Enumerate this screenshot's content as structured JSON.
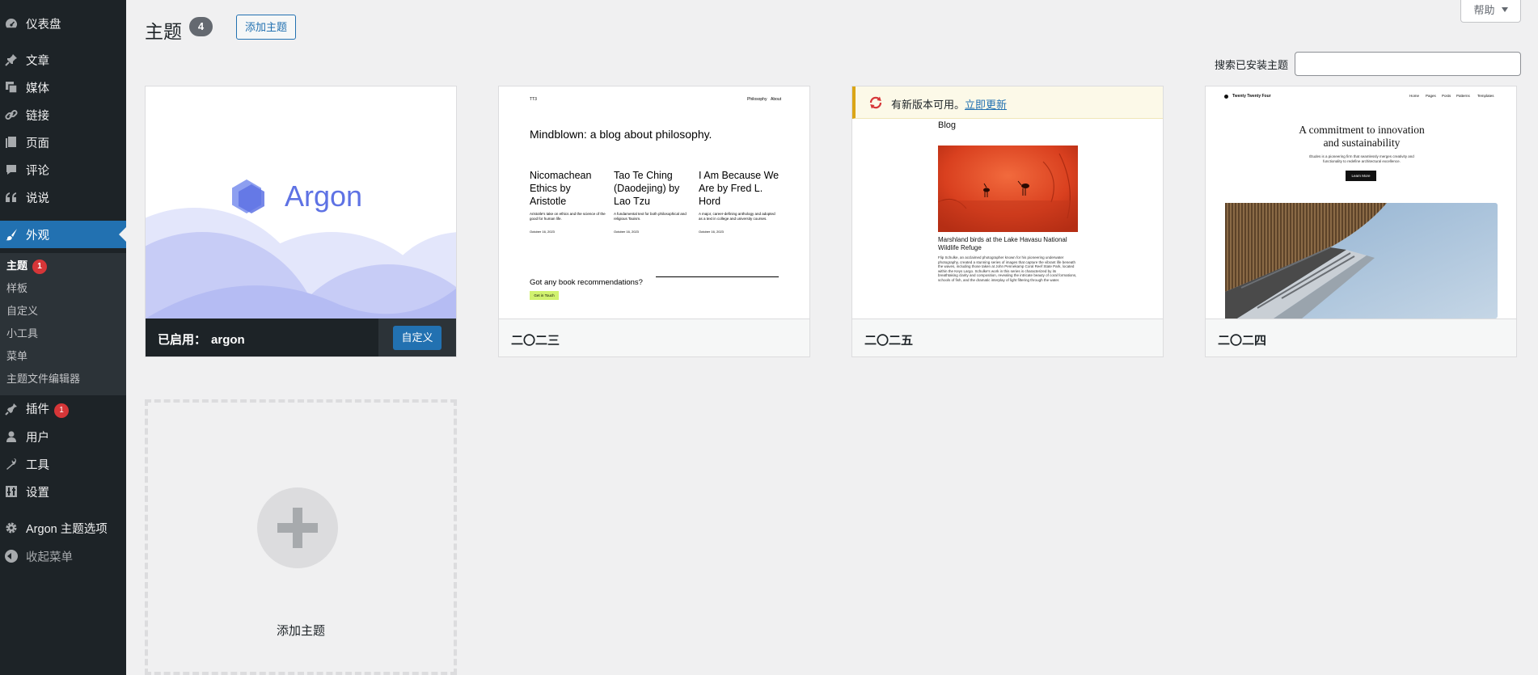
{
  "sidebar": {
    "menu": [
      {
        "label": "仪表盘",
        "icon": "dashboard-icon"
      },
      {
        "label": "文章",
        "icon": "pushpin-icon"
      },
      {
        "label": "媒体",
        "icon": "media-icon"
      },
      {
        "label": "链接",
        "icon": "link-icon"
      },
      {
        "label": "页面",
        "icon": "page-icon"
      },
      {
        "label": "评论",
        "icon": "comment-icon"
      },
      {
        "label": "说说",
        "icon": "quote-icon"
      },
      {
        "label": "外观",
        "icon": "paintbrush-icon"
      },
      {
        "label": "插件",
        "icon": "plugin-icon",
        "badge": "1"
      },
      {
        "label": "用户",
        "icon": "user-icon"
      },
      {
        "label": "工具",
        "icon": "wrench-icon"
      },
      {
        "label": "设置",
        "icon": "settings-icon"
      },
      {
        "label": "Argon 主题选项",
        "icon": "gear-icon"
      }
    ],
    "submenu": [
      {
        "label": "主题",
        "badge": "1"
      },
      {
        "label": "样板"
      },
      {
        "label": "自定义"
      },
      {
        "label": "小工具"
      },
      {
        "label": "菜单"
      },
      {
        "label": "主题文件编辑器"
      }
    ],
    "collapse_label": "收起菜单"
  },
  "header": {
    "title": "主题",
    "count": "4",
    "add_button": "添加主题",
    "help_label": "帮助"
  },
  "search": {
    "label": "搜索已安装主题",
    "value": ""
  },
  "themes": [
    {
      "name": "argon",
      "active_prefix": "已启用：",
      "customize_label": "自定义",
      "preview_title": "Argon"
    },
    {
      "name": "二〇二三",
      "preview": {
        "site": "TT3",
        "nav": [
          "Philosophy",
          "About"
        ],
        "heading": "Mindblown: a blog about philosophy.",
        "posts": [
          {
            "title": "Nicomachean Ethics by Aristotle",
            "excerpt": "Aristotle's take on ethics and the science of the good for human life.",
            "date": "October 16, 2023"
          },
          {
            "title": "Tao Te Ching (Daodejing) by Lao Tzu",
            "excerpt": "A fundamental text for both philosophical and religious Taoism.",
            "date": "October 16, 2023"
          },
          {
            "title": "I Am Because We Are by Fred L. Hord",
            "excerpt": "A major, career-defining anthology and adopted as a text in college and university courses.",
            "date": "October 16, 2023"
          }
        ],
        "cta_text": "Got any book recommendations?",
        "cta_button": "Get in Touch"
      }
    },
    {
      "name": "二〇二五",
      "update_text": "有新版本可用。",
      "update_link": "立即更新",
      "preview": {
        "heading": "Blog",
        "caption": "Marshland birds at the Lake Havasu National Wildlife Refuge",
        "body": "Flip Schulke, an acclaimed photographer known for his pioneering underwater photography, created a stunning series of images that capture the vibrant life beneath the waves, including those taken at John Pennekamp Coral Reef State Park, located within the Keys Largo. Schulke's work in this series is characterized by its breathtaking clarity and composition, revealing the intricate beauty of coral formations, schools of fish, and the dramatic interplay of light filtering through the water."
      }
    },
    {
      "name": "二〇二四",
      "preview": {
        "site": "Twenty Twenty Four",
        "nav": [
          "Home",
          "Pages",
          "Posts",
          "Patterns",
          "Templates"
        ],
        "heading": "A commitment to innovation and sustainability",
        "sub": "Études is a pioneering firm that seamlessly merges creativity and functionality to redefine architectural excellence.",
        "button": "Learn More"
      }
    }
  ],
  "add_new_card": {
    "label": "添加主题"
  }
}
